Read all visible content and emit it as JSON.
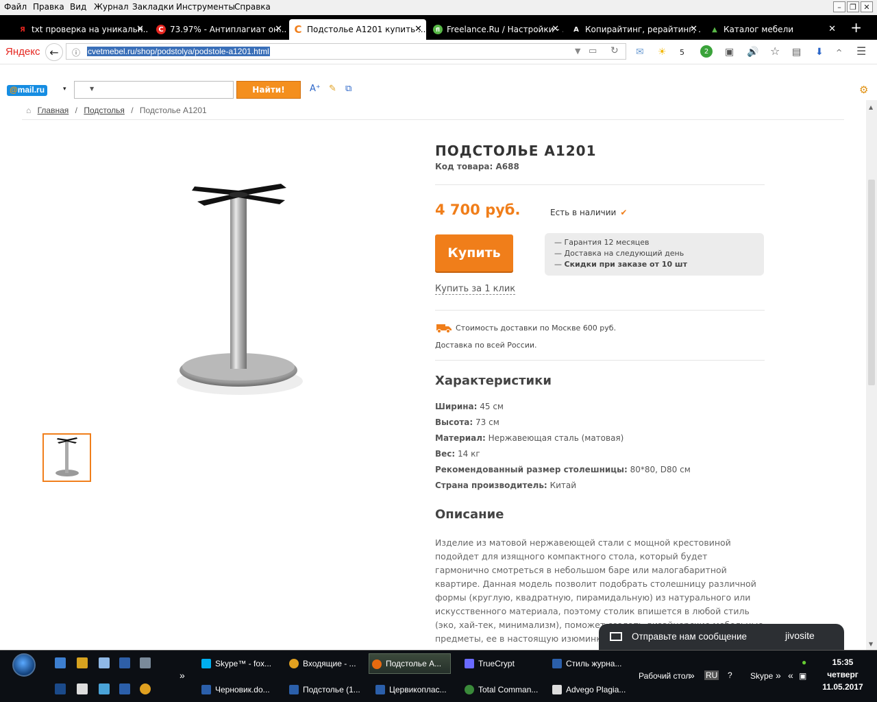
{
  "menubar": {
    "items": [
      "Файл",
      "Правка",
      "Вид",
      "Журнал",
      "Закладки",
      "Инструменты",
      "Справка"
    ]
  },
  "tabs": [
    {
      "label": "txt проверка на уникальн...",
      "icon": "Я",
      "icon_color": "#e52620"
    },
    {
      "label": "73.97% - Антиплагиат он...",
      "icon": "C",
      "icon_color": "#e52620"
    },
    {
      "label": "Подстолье A1201 купить ...",
      "icon": "C",
      "icon_color": "#f07e1a",
      "active": true
    },
    {
      "label": "Freelance.Ru / Настройки - ...",
      "icon": "fl",
      "icon_color": "#58b847"
    },
    {
      "label": "Копирайтинг, рерайтинг, ...",
      "icon": "A",
      "icon_color": "#ffffff"
    },
    {
      "label": "Каталог мебели",
      "icon": "▲",
      "icon_color": "#58b847"
    }
  ],
  "navbar": {
    "brand": "Яндекс",
    "url": "cvetmebel.ru/shop/podstolya/podstole-a1201.html",
    "weather_value": "5",
    "badge_count": "2"
  },
  "mailbar": {
    "logo_at": "@",
    "logo_text": "mail.ru",
    "search_button": "Найти!"
  },
  "breadcrumb": {
    "home": "Главная",
    "category": "Подстолья",
    "current": "Подстолье А1201",
    "sep": "/"
  },
  "product": {
    "title": "ПОДСТОЛЬЕ А1201",
    "code": "Код товара: А688",
    "price": "4 700 руб.",
    "stock": "Есть в наличии",
    "buy_button": "Купить",
    "one_click": "Купить за 1 клик",
    "perks": [
      "— Гарантия 12 месяцев",
      "— Доставка на следующий день"
    ],
    "perk_bold_prefix": "— ",
    "perk_bold": "Скидки при заказе от 10 шт",
    "delivery_moscow": "Стоимость доставки по Москве 600 руб.",
    "delivery_russia": "Доставка по всей России."
  },
  "specs": {
    "heading": "Характеристики",
    "items": [
      {
        "label": "Ширина:",
        "value": "45 см"
      },
      {
        "label": "Высота:",
        "value": "73 см"
      },
      {
        "label": "Материал:",
        "value": "Нержавеющая сталь (матовая)"
      },
      {
        "label": "Вес:",
        "value": "14 кг"
      },
      {
        "label": "Рекомендованный размер столешницы:",
        "value": "80*80, D80 см"
      },
      {
        "label": "Страна производитель:",
        "value": "Китай"
      }
    ]
  },
  "description": {
    "heading": "Описание",
    "text": "Изделие из матовой нержавеющей стали с мощной крестовиной подойдет для изящного компактного стола, который будет гармонично смотреться в небольшом баре или малогабаритной квартире. Данная модель позволит подобрать столешницу различной формы (круглую, квадратную, пирамидальную) из натурального или искусственного материала, поэтому столик впишется в любой стиль (эко, хай-тек, минимализм), поможет создать дизайнерские мебельные предметы, ее в настоящую изюминку. Прочное осно..."
  },
  "jivo": {
    "message": "Отправьте нам сообщение",
    "brand": "jivosite"
  },
  "taskbar": {
    "row1": [
      {
        "label": "Skype™ - fox...",
        "color": "#00aff0"
      },
      {
        "label": "Входящие - ...",
        "color": "#e0a020"
      },
      {
        "label": "Подстолье А...",
        "color": "#e86a10",
        "active": true
      },
      {
        "label": "TrueCrypt",
        "color": "#6a6aff"
      },
      {
        "label": "Стиль журна...",
        "color": "#2b5faa"
      }
    ],
    "row2": [
      {
        "label": "Черновик.do...",
        "color": "#2b5faa"
      },
      {
        "label": "Подстолье (1...",
        "color": "#2b5faa"
      },
      {
        "label": "Цервикоплас...",
        "color": "#2b5faa"
      },
      {
        "label": "Total Comman...",
        "color": "#3a8a3a"
      },
      {
        "label": "Advego Plagia...",
        "color": "#dddddd"
      }
    ],
    "desktop": "Рабочий стол",
    "lang": "RU",
    "skype": "Skype",
    "time": "15:35",
    "day": "четверг",
    "date": "11.05.2017"
  }
}
